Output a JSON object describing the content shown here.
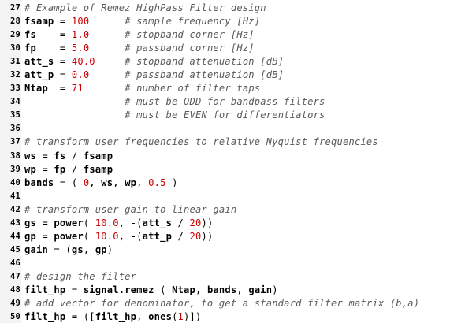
{
  "editor": {
    "lines": [
      {
        "n": "27",
        "tokens": [
          {
            "t": "com",
            "v": "# Example of Remez HighPass Filter design"
          }
        ]
      },
      {
        "n": "28",
        "tokens": [
          {
            "t": "kw",
            "v": "fsamp"
          },
          {
            "t": "op",
            "v": " = "
          },
          {
            "t": "num",
            "v": "100"
          },
          {
            "t": "op",
            "v": "      "
          },
          {
            "t": "com",
            "v": "# sample frequency [Hz]"
          }
        ]
      },
      {
        "n": "29",
        "tokens": [
          {
            "t": "kw",
            "v": "fs"
          },
          {
            "t": "op",
            "v": "    = "
          },
          {
            "t": "num",
            "v": "1.0"
          },
          {
            "t": "op",
            "v": "      "
          },
          {
            "t": "com",
            "v": "# stopband corner [Hz]"
          }
        ]
      },
      {
        "n": "30",
        "tokens": [
          {
            "t": "kw",
            "v": "fp"
          },
          {
            "t": "op",
            "v": "    = "
          },
          {
            "t": "num",
            "v": "5.0"
          },
          {
            "t": "op",
            "v": "      "
          },
          {
            "t": "com",
            "v": "# passband corner [Hz]"
          }
        ]
      },
      {
        "n": "31",
        "tokens": [
          {
            "t": "kw",
            "v": "att_s"
          },
          {
            "t": "op",
            "v": " = "
          },
          {
            "t": "num",
            "v": "40.0"
          },
          {
            "t": "op",
            "v": "     "
          },
          {
            "t": "com",
            "v": "# stopband attenuation [dB]"
          }
        ]
      },
      {
        "n": "32",
        "tokens": [
          {
            "t": "kw",
            "v": "att_p"
          },
          {
            "t": "op",
            "v": " = "
          },
          {
            "t": "num",
            "v": "0.0"
          },
          {
            "t": "op",
            "v": "      "
          },
          {
            "t": "com",
            "v": "# passband attenuation [dB]"
          }
        ]
      },
      {
        "n": "33",
        "tokens": [
          {
            "t": "kw",
            "v": "Ntap"
          },
          {
            "t": "op",
            "v": "  = "
          },
          {
            "t": "num",
            "v": "71"
          },
          {
            "t": "op",
            "v": "       "
          },
          {
            "t": "com",
            "v": "# number of filter taps"
          }
        ]
      },
      {
        "n": "34",
        "tokens": [
          {
            "t": "op",
            "v": "                 "
          },
          {
            "t": "com",
            "v": "# must be ODD for bandpass filters"
          }
        ]
      },
      {
        "n": "35",
        "tokens": [
          {
            "t": "op",
            "v": "                 "
          },
          {
            "t": "com",
            "v": "# must be EVEN for differentiators"
          }
        ]
      },
      {
        "n": "36",
        "tokens": []
      },
      {
        "n": "37",
        "tokens": [
          {
            "t": "com",
            "v": "# transform user frequencies to relative Nyquist frequencies"
          }
        ]
      },
      {
        "n": "38",
        "tokens": [
          {
            "t": "kw",
            "v": "ws"
          },
          {
            "t": "op",
            "v": " = "
          },
          {
            "t": "kw",
            "v": "fs"
          },
          {
            "t": "op",
            "v": " / "
          },
          {
            "t": "kw",
            "v": "fsamp"
          }
        ]
      },
      {
        "n": "39",
        "tokens": [
          {
            "t": "kw",
            "v": "wp"
          },
          {
            "t": "op",
            "v": " = "
          },
          {
            "t": "kw",
            "v": "fp"
          },
          {
            "t": "op",
            "v": " / "
          },
          {
            "t": "kw",
            "v": "fsamp"
          }
        ]
      },
      {
        "n": "40",
        "tokens": [
          {
            "t": "kw",
            "v": "bands"
          },
          {
            "t": "op",
            "v": " = ( "
          },
          {
            "t": "num",
            "v": "0"
          },
          {
            "t": "op",
            "v": ", "
          },
          {
            "t": "kw",
            "v": "ws"
          },
          {
            "t": "op",
            "v": ", "
          },
          {
            "t": "kw",
            "v": "wp"
          },
          {
            "t": "op",
            "v": ", "
          },
          {
            "t": "num",
            "v": "0.5"
          },
          {
            "t": "op",
            "v": " )"
          }
        ]
      },
      {
        "n": "41",
        "tokens": []
      },
      {
        "n": "42",
        "tokens": [
          {
            "t": "com",
            "v": "# transform user gain to linear gain"
          }
        ]
      },
      {
        "n": "43",
        "tokens": [
          {
            "t": "kw",
            "v": "gs"
          },
          {
            "t": "op",
            "v": " = "
          },
          {
            "t": "kw",
            "v": "power"
          },
          {
            "t": "op",
            "v": "( "
          },
          {
            "t": "num",
            "v": "10.0"
          },
          {
            "t": "op",
            "v": ", -("
          },
          {
            "t": "kw",
            "v": "att_s"
          },
          {
            "t": "op",
            "v": " / "
          },
          {
            "t": "num",
            "v": "20"
          },
          {
            "t": "op",
            "v": "))"
          }
        ]
      },
      {
        "n": "44",
        "tokens": [
          {
            "t": "kw",
            "v": "gp"
          },
          {
            "t": "op",
            "v": " = "
          },
          {
            "t": "kw",
            "v": "power"
          },
          {
            "t": "op",
            "v": "( "
          },
          {
            "t": "num",
            "v": "10.0"
          },
          {
            "t": "op",
            "v": ", -("
          },
          {
            "t": "kw",
            "v": "att_p"
          },
          {
            "t": "op",
            "v": " / "
          },
          {
            "t": "num",
            "v": "20"
          },
          {
            "t": "op",
            "v": "))"
          }
        ]
      },
      {
        "n": "45",
        "tokens": [
          {
            "t": "kw",
            "v": "gain"
          },
          {
            "t": "op",
            "v": " = ("
          },
          {
            "t": "kw",
            "v": "gs"
          },
          {
            "t": "op",
            "v": ", "
          },
          {
            "t": "kw",
            "v": "gp"
          },
          {
            "t": "op",
            "v": ")"
          }
        ]
      },
      {
        "n": "46",
        "tokens": []
      },
      {
        "n": "47",
        "tokens": [
          {
            "t": "com",
            "v": "# design the filter"
          }
        ]
      },
      {
        "n": "48",
        "tokens": [
          {
            "t": "kw",
            "v": "filt_hp"
          },
          {
            "t": "op",
            "v": " = "
          },
          {
            "t": "kw",
            "v": "signal.remez"
          },
          {
            "t": "op",
            "v": " ( "
          },
          {
            "t": "kw",
            "v": "Ntap"
          },
          {
            "t": "op",
            "v": ", "
          },
          {
            "t": "kw",
            "v": "bands"
          },
          {
            "t": "op",
            "v": ", "
          },
          {
            "t": "kw",
            "v": "gain"
          },
          {
            "t": "op",
            "v": ")"
          }
        ]
      },
      {
        "n": "49",
        "tokens": [
          {
            "t": "com",
            "v": "# add vector for denominator, to get a standard filter matrix (b,a)"
          }
        ]
      },
      {
        "n": "50",
        "tokens": [
          {
            "t": "kw",
            "v": "filt_hp"
          },
          {
            "t": "op",
            "v": " = (["
          },
          {
            "t": "kw",
            "v": "filt_hp"
          },
          {
            "t": "op",
            "v": ", "
          },
          {
            "t": "kw",
            "v": "ones"
          },
          {
            "t": "op",
            "v": "("
          },
          {
            "t": "num",
            "v": "1"
          },
          {
            "t": "op",
            "v": ")])"
          }
        ]
      }
    ]
  }
}
